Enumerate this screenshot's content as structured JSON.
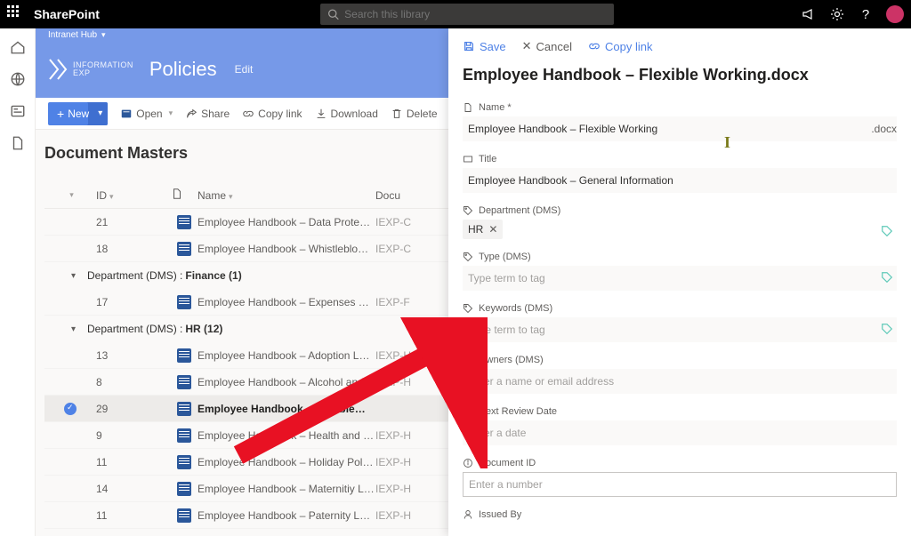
{
  "topbar": {
    "brand": "SharePoint",
    "search_placeholder": "Search this library"
  },
  "hub": {
    "name": "Intranet Hub"
  },
  "site": {
    "logo_top": "INFORMATION",
    "logo_bottom": "EXP",
    "title": "Policies",
    "edit": "Edit"
  },
  "cmdbar": {
    "new": "New",
    "open": "Open",
    "share": "Share",
    "copylink": "Copy link",
    "download": "Download",
    "delete": "Delete"
  },
  "library": {
    "title": "Document Masters",
    "columns": {
      "id": "ID",
      "name": "Name",
      "doc": "Docu"
    },
    "rows_top": [
      {
        "id": "21",
        "name": "Employee Handbook – Data Protection.docx",
        "doc": "IEXP-C"
      },
      {
        "id": "18",
        "name": "Employee Handbook – Whistleblowing Poli…",
        "doc": "IEXP-C"
      }
    ],
    "group_finance": {
      "label": "Department (DMS) :",
      "value": "Finance (1)"
    },
    "rows_finance": [
      {
        "id": "17",
        "name": "Employee Handbook – Expenses Policy and…",
        "doc": "IEXP-F"
      }
    ],
    "group_hr": {
      "label": "Department (DMS) :",
      "value": "HR (12)"
    },
    "rows_hr": [
      {
        "id": "13",
        "name": "Employee Handbook – Adoption Leave.docx",
        "doc": "IEXP-H"
      },
      {
        "id": "8",
        "name": "Employee Handbook – Alcohol and Drugs P…",
        "doc": "IEXP-H"
      },
      {
        "id": "29",
        "name": "Employee Handbook – Flexible…",
        "doc": "",
        "selected": true
      },
      {
        "id": "9",
        "name": "Employee Handbook – Health and Safety.d…",
        "doc": "IEXP-H"
      },
      {
        "id": "11",
        "name": "Employee Handbook – Holiday Policy.docx",
        "doc": "IEXP-H"
      },
      {
        "id": "14",
        "name": "Employee Handbook – Maternitiy Leave an…",
        "doc": "IEXP-H"
      },
      {
        "id": "11",
        "name": "Employee Handbook – Paternity Leave an…",
        "doc": "IEXP-H"
      }
    ]
  },
  "panel": {
    "actions": {
      "save": "Save",
      "cancel": "Cancel",
      "copylink": "Copy link"
    },
    "title": "Employee Handbook – Flexible Working.docx",
    "fields": {
      "name": {
        "label": "Name *",
        "value": "Employee Handbook – Flexible Working",
        "ext": ".docx"
      },
      "title": {
        "label": "Title",
        "value": "Employee Handbook – General Information"
      },
      "department": {
        "label": "Department (DMS)",
        "chip": "HR"
      },
      "type": {
        "label": "Type (DMS)",
        "placeholder": "Type term to tag"
      },
      "keywords": {
        "label": "Keywords (DMS)",
        "placeholder": "Type term to tag"
      },
      "owners": {
        "label": "Owners (DMS)",
        "placeholder": "Enter a name or email address"
      },
      "nextreview": {
        "label": "Next Review Date",
        "placeholder": "Enter a date"
      },
      "docid": {
        "label": "Document ID",
        "placeholder": "Enter a number"
      },
      "issuedby": {
        "label": "Issued By"
      }
    }
  }
}
